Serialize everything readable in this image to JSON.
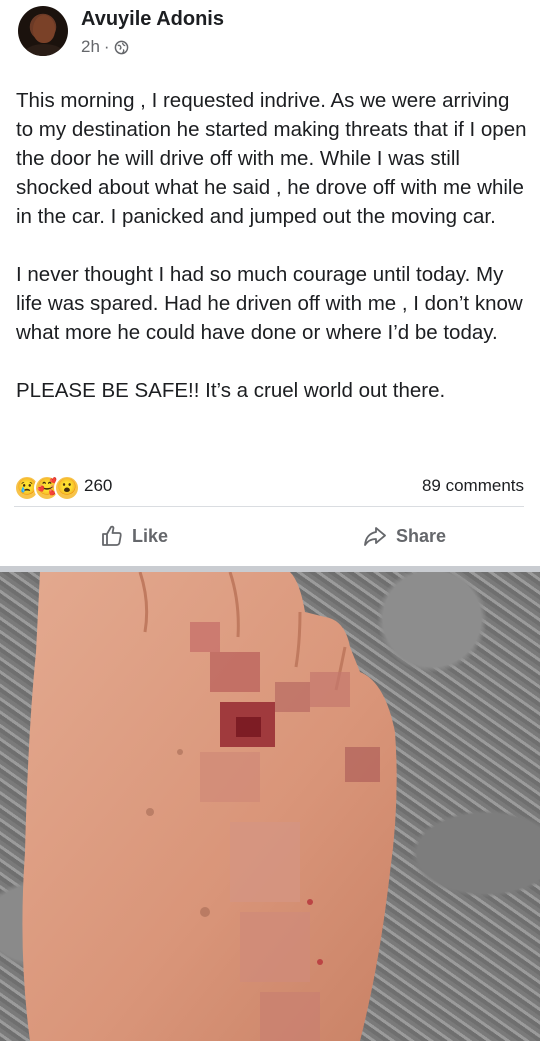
{
  "post": {
    "author": "Avuyile Adonis",
    "time": "2h",
    "dot": "·",
    "audience_icon": "globe-icon",
    "paragraphs": [
      "This morning , I requested indrive. As we were arriving to my destination he started making threats that if I open the door he will drive off with me. While I was still shocked about what he said , he drove off with me while in the car. I panicked and jumped out the moving car.",
      "I never thought I had so much courage until today. My life was spared. Had he driven off with me , I don’t know what more he could have done or where I’d be today.",
      "PLEASE BE SAFE!! It’s a cruel world out there."
    ],
    "reactions": {
      "icons": [
        "sad-reaction-icon",
        "care-reaction-icon",
        "wow-reaction-icon"
      ],
      "count": "260"
    },
    "comments": "89 comments",
    "actions": {
      "like": "Like",
      "share": "Share"
    }
  },
  "colors": {
    "text": "#1c1e21",
    "secondary": "#65676b",
    "divider": "#dadde1"
  }
}
